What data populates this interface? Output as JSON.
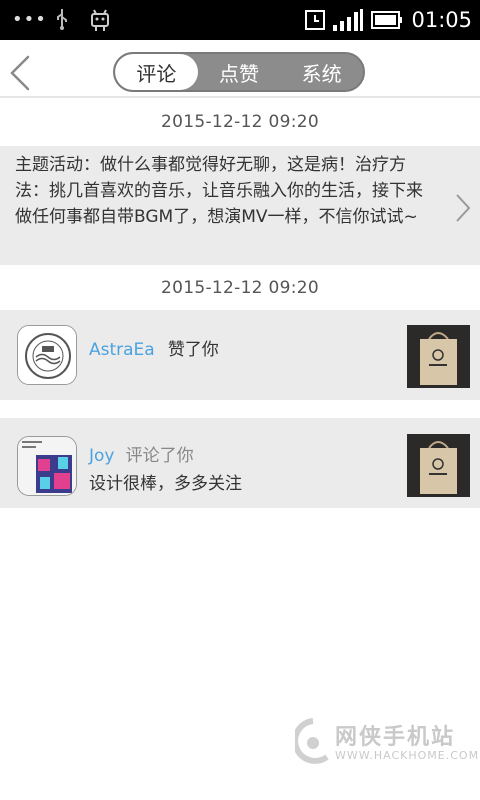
{
  "status_bar": {
    "dots": "•••",
    "time": "01:05"
  },
  "header": {
    "tabs": [
      {
        "label": "评论",
        "active": true
      },
      {
        "label": "点赞",
        "active": false
      },
      {
        "label": "系统",
        "active": false
      }
    ]
  },
  "feed": {
    "groups": [
      {
        "timestamp": "2015-12-12  09:20",
        "system_message": "主题活动：做什么事都觉得好无聊，这是病！治疗方法：挑几首喜欢的音乐，让音乐融入你的生活，接下来做任何事都自带BGM了，想演MV一样，不信你试试~"
      },
      {
        "timestamp": "2015-12-12  09:20",
        "notifications": [
          {
            "username": "AstraEa",
            "action": "赞了你",
            "comment": ""
          },
          {
            "username": "Joy",
            "action": "评论了你",
            "comment": "设计很棒，多多关注"
          }
        ]
      }
    ]
  },
  "watermark": {
    "title": "网侠手机站",
    "url": "WWW.HACKHOME.COM"
  },
  "colors": {
    "accent_username": "#4aa3e0",
    "row_background": "#ebebeb",
    "segmented_control": "#8c8c8c"
  }
}
